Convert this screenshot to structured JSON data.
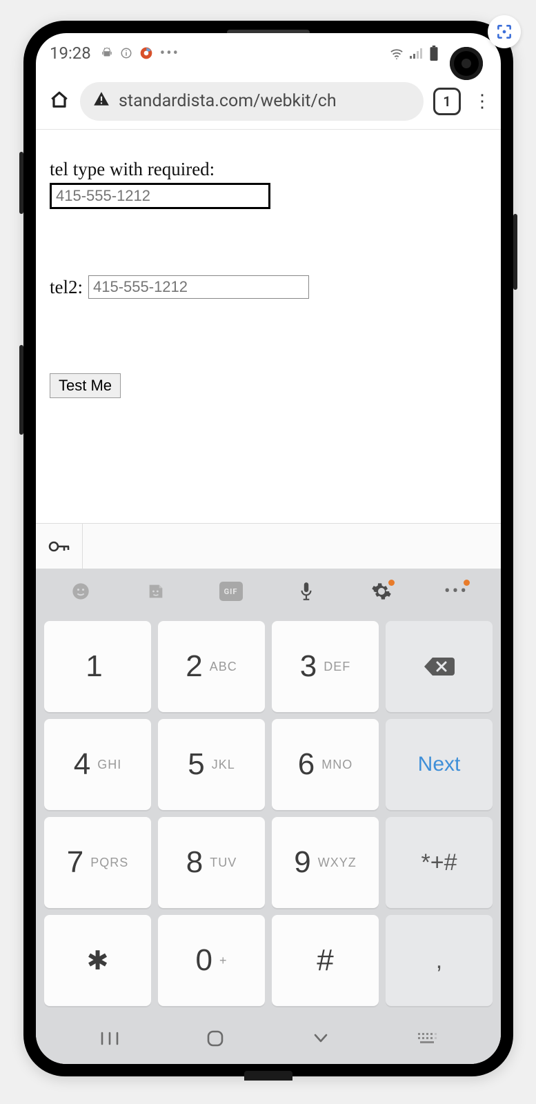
{
  "statusbar": {
    "time": "19:28"
  },
  "browser": {
    "url": "standardista.com/webkit/ch",
    "tab_count": "1"
  },
  "page": {
    "label1": "tel type with required:",
    "tel1_placeholder": "415-555-1212",
    "label2": "tel2:",
    "tel2_placeholder": "415-555-1212",
    "button": "Test Me"
  },
  "keyboard": {
    "toolbar": {
      "gif": "GIF"
    },
    "keys": [
      {
        "n": "1",
        "s": ""
      },
      {
        "n": "2",
        "s": "ABC"
      },
      {
        "n": "3",
        "s": "DEF"
      },
      {
        "type": "backspace"
      },
      {
        "n": "4",
        "s": "GHI"
      },
      {
        "n": "5",
        "s": "JKL"
      },
      {
        "n": "6",
        "s": "MNO"
      },
      {
        "type": "next",
        "label": "Next"
      },
      {
        "n": "7",
        "s": "PQRS"
      },
      {
        "n": "8",
        "s": "TUV"
      },
      {
        "n": "9",
        "s": "WXYZ"
      },
      {
        "type": "sym",
        "label": "*+#"
      },
      {
        "type": "star",
        "label": "✱"
      },
      {
        "n": "0",
        "s": "+"
      },
      {
        "type": "hash",
        "label": "#"
      },
      {
        "type": "comma",
        "label": ","
      }
    ]
  }
}
